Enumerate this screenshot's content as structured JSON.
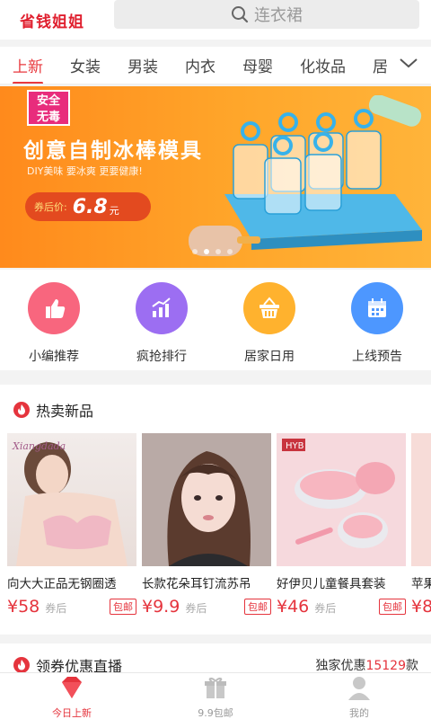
{
  "header": {
    "logo": "省钱姐姐",
    "search_placeholder": "连衣裙"
  },
  "tabs": [
    "上新",
    "女装",
    "男装",
    "内衣",
    "母婴",
    "化妆品",
    "居"
  ],
  "banner": {
    "badge_line1": "安全",
    "badge_line2": "无毒",
    "headline": "创意自制冰棒模具",
    "subline": "DIY美味  要冰爽  更要健康!",
    "price_label": "券后价:",
    "price_value": "6.8",
    "price_unit": "元",
    "slide_count": 4,
    "active_slide": 1
  },
  "categories": [
    {
      "label": "小编推荐",
      "icon": "thumbs-up-icon",
      "color": "#f8667e"
    },
    {
      "label": "疯抢排行",
      "icon": "trend-chart-icon",
      "color": "#9c6ef2"
    },
    {
      "label": "居家日用",
      "icon": "basket-icon",
      "color": "#ffb22e"
    },
    {
      "label": "上线预告",
      "icon": "calendar-icon",
      "color": "#4d97ff"
    }
  ],
  "hot_section": {
    "title": "热卖新品",
    "products": [
      {
        "name": "向大大正品无钢圈透",
        "price": "¥58",
        "after": "券后",
        "tag": "包邮"
      },
      {
        "name": "长款花朵耳钉流苏吊",
        "price": "¥9.9",
        "after": "券后",
        "tag": "包邮"
      },
      {
        "name": "好伊贝儿童餐具套装",
        "price": "¥46",
        "after": "券后",
        "tag": "包邮"
      },
      {
        "name": "苹果",
        "price": "¥8",
        "after": "",
        "tag": ""
      }
    ]
  },
  "coupon_section": {
    "title": "领券优惠直播",
    "right_prefix": "独家优惠",
    "right_count": "15129",
    "right_suffix": "款"
  },
  "tabbar": [
    {
      "label": "今日上新",
      "icon": "gem-icon"
    },
    {
      "label": "9.9包邮",
      "icon": "gift-icon"
    },
    {
      "label": "我的",
      "icon": "person-icon"
    }
  ],
  "colors": {
    "accent": "#e5343d",
    "banner": "#ff9a24"
  }
}
